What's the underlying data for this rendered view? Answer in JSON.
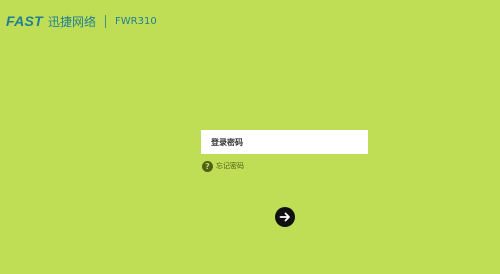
{
  "header": {
    "logo": "FAST",
    "brand": "迅捷网络",
    "model": "FWR310"
  },
  "login": {
    "password_placeholder": "登录密码",
    "forgot_icon": "?",
    "forgot_label": "忘记密码",
    "submit_icon": "arrow-right-icon"
  },
  "colors": {
    "background": "#c0de55",
    "brand": "#1f7f95",
    "button": "#111111"
  }
}
